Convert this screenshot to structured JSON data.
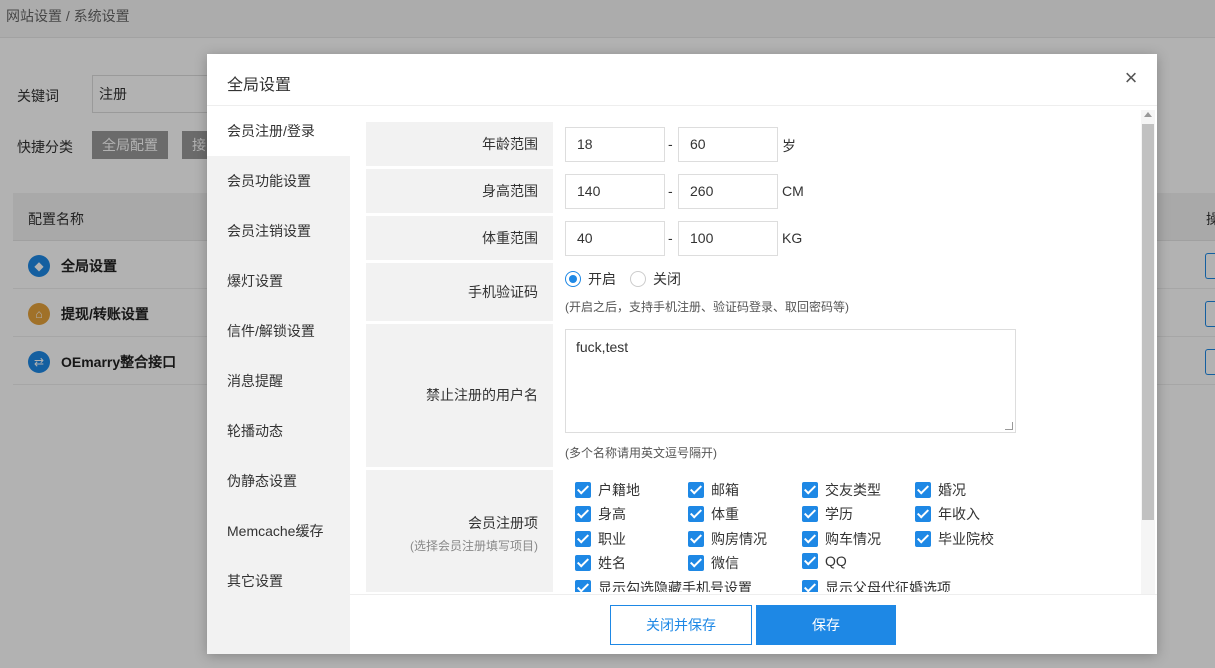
{
  "background": {
    "breadcrumb": "网站设置 / 系统设置",
    "keyword_label": "关键词",
    "keyword_value": "注册",
    "category_label": "快捷分类",
    "category_buttons": [
      "全局配置",
      "接"
    ],
    "table_header_name": "配置名称",
    "table_header_op": "操",
    "rows": [
      {
        "name": "全局设置",
        "icon": "cube-icon",
        "color": "#1e88e5"
      },
      {
        "name": "提现/转账设置",
        "icon": "home-icon",
        "color": "#e6a23c"
      },
      {
        "name": "OEmarry整合接口",
        "icon": "link-icon",
        "color": "#1e88e5"
      }
    ]
  },
  "modal": {
    "title": "全局设置",
    "close_icon": "×",
    "nav": [
      "会员注册/登录",
      "会员功能设置",
      "会员注销设置",
      "爆灯设置",
      "信件/解锁设置",
      "消息提醒",
      "轮播动态",
      "伪静态设置",
      "Memcache缓存",
      "其它设置"
    ],
    "age": {
      "label": "年龄范围",
      "min": "18",
      "max": "60",
      "unit": "岁"
    },
    "height": {
      "label": "身高范围",
      "min": "140",
      "max": "260",
      "unit": "CM"
    },
    "weight": {
      "label": "体重范围",
      "min": "40",
      "max": "100",
      "unit": "KG"
    },
    "range_sep": "-",
    "phone": {
      "label": "手机验证码",
      "on": "开启",
      "off": "关闭",
      "selected": "on",
      "hint": "(开启之后，支持手机注册、验证码登录、取回密码等)"
    },
    "banned": {
      "label": "禁止注册的用户名",
      "value": "fuck,test",
      "hint": "(多个名称请用英文逗号隔开)"
    },
    "reg_items": {
      "label": "会员注册项",
      "sub": "(选择会员注册填写项目)",
      "items": [
        "户籍地",
        "邮箱",
        "交友类型",
        "婚况",
        "身高",
        "体重",
        "学历",
        "年收入",
        "职业",
        "购房情况",
        "购车情况",
        "毕业院校",
        "姓名",
        "微信",
        "QQ",
        "显示勾选隐藏手机号设置",
        "显示父母代征婚选项"
      ]
    },
    "footer": {
      "close_save": "关闭并保存",
      "save": "保存"
    },
    "accent": "#1e88e5"
  }
}
